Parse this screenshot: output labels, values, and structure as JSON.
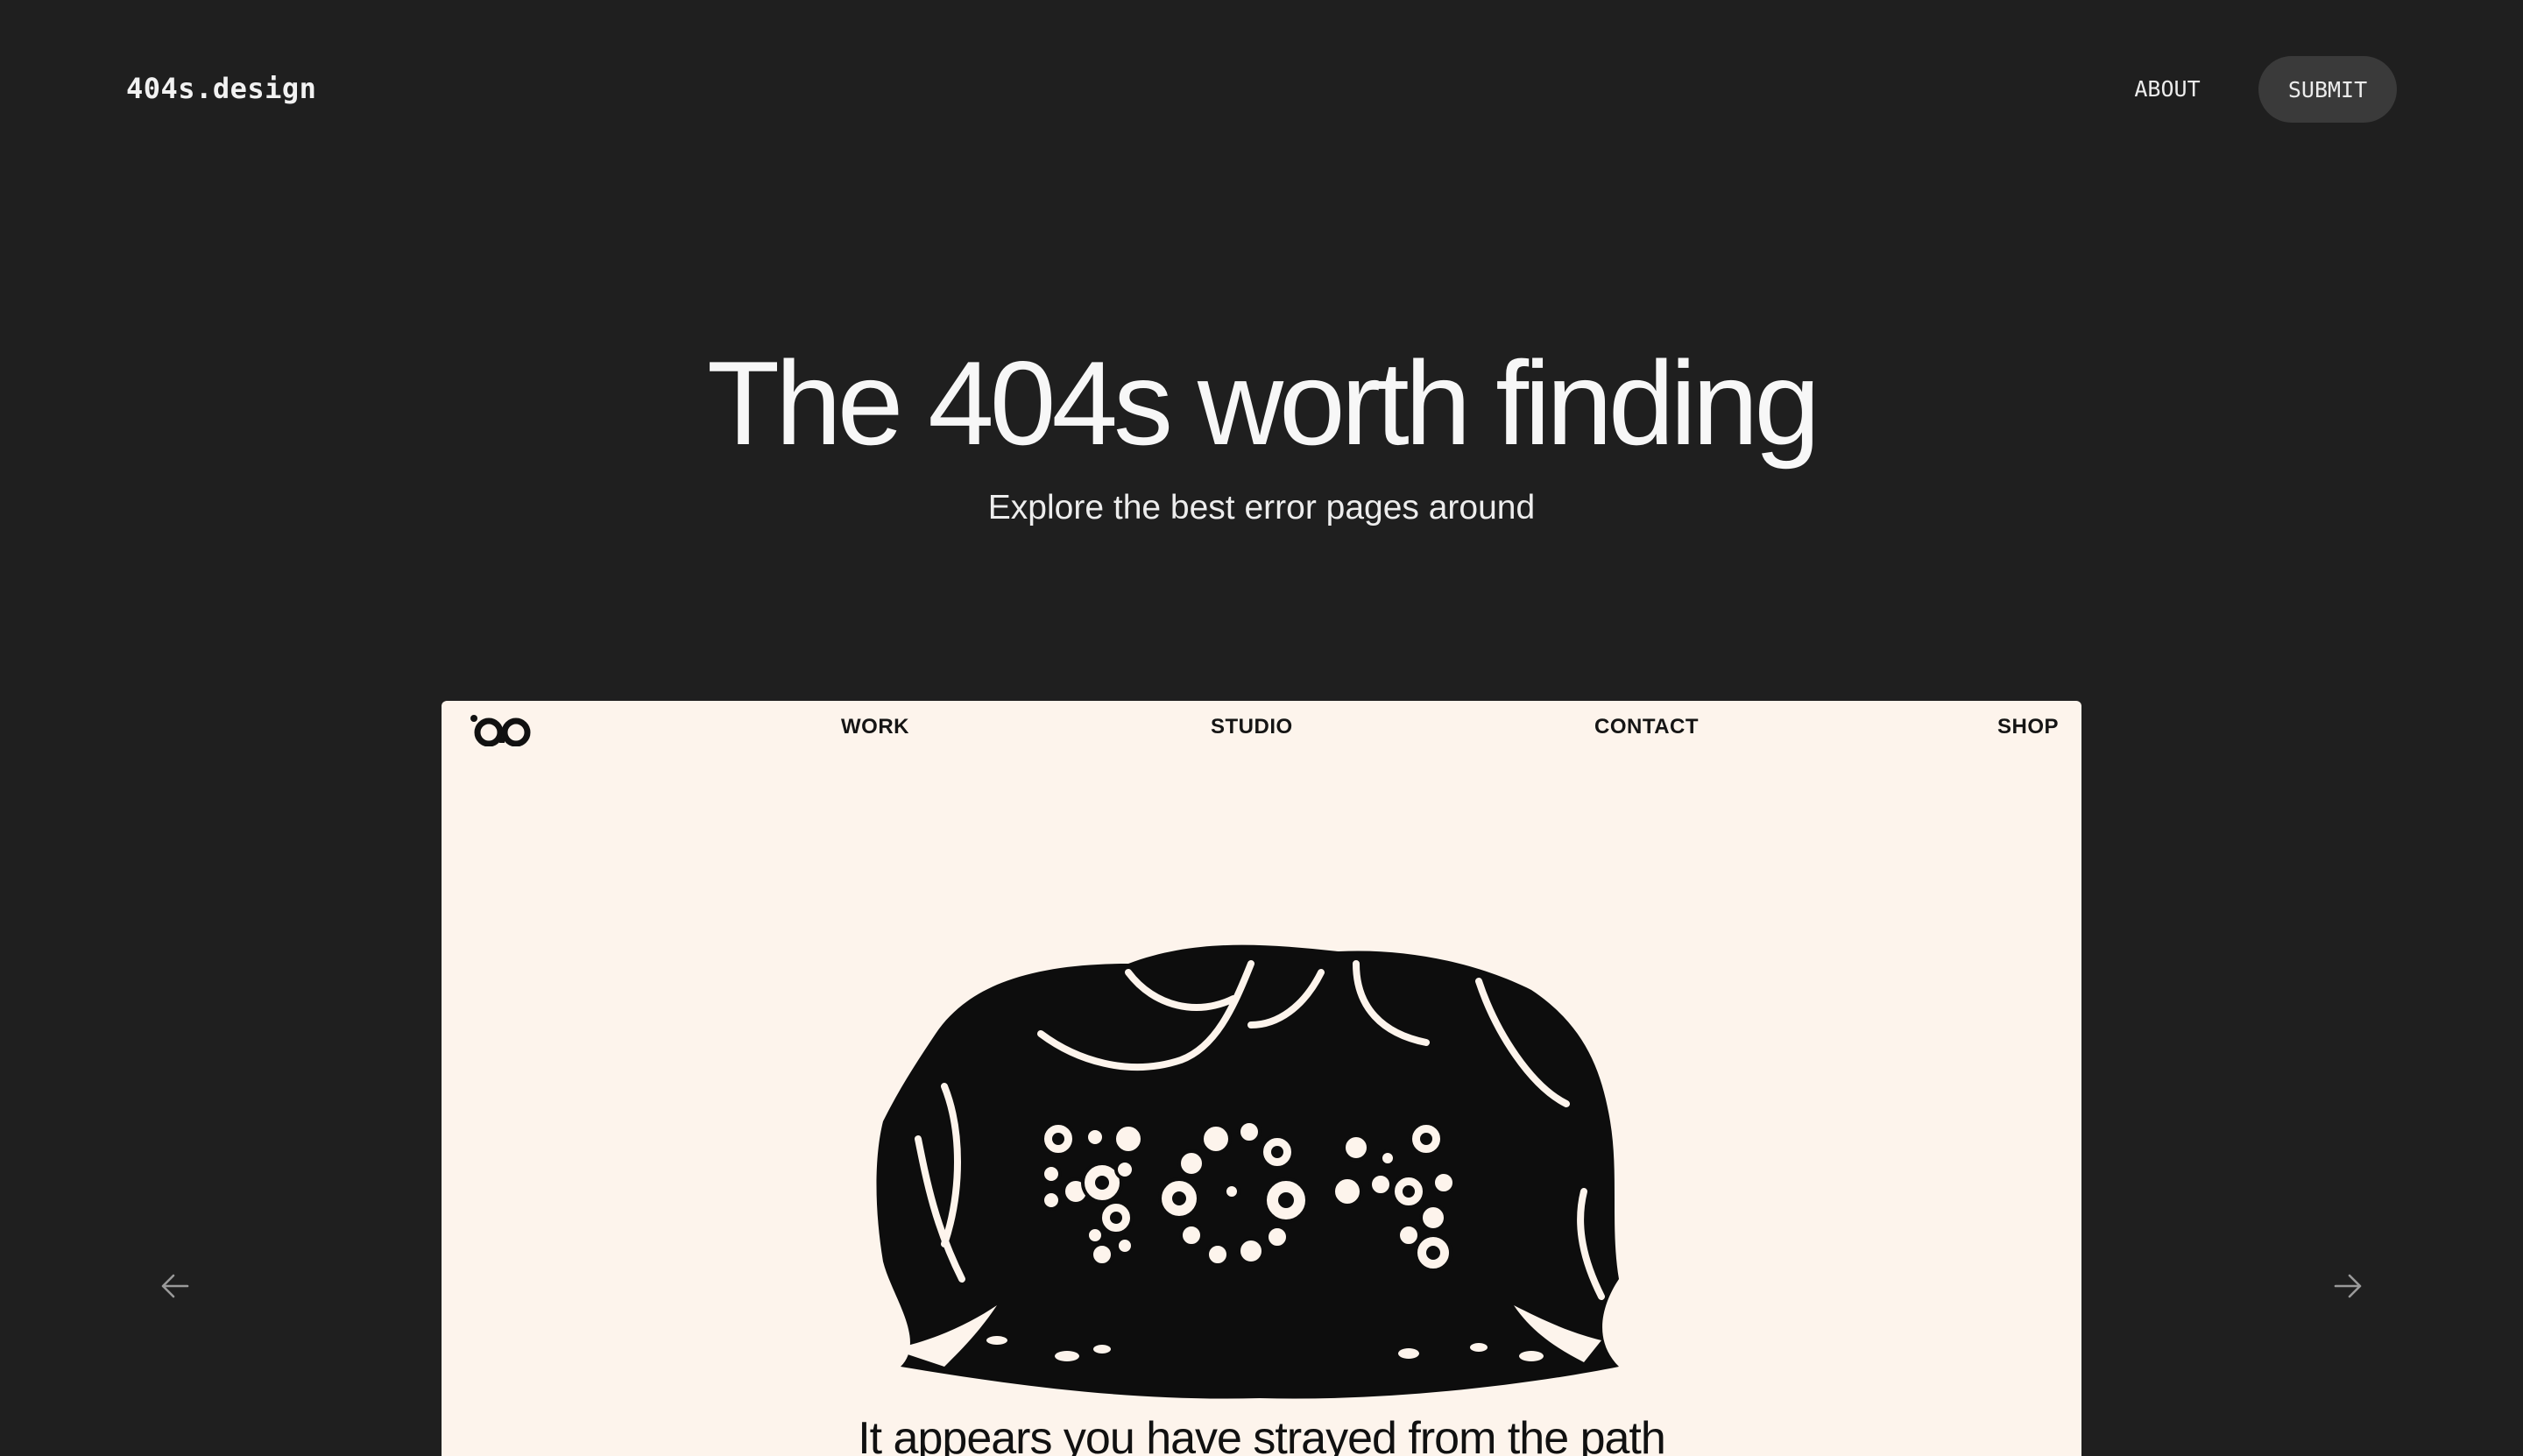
{
  "site": {
    "logo": "404s.design",
    "nav": {
      "about": "ABOUT",
      "submit": "SUBMIT"
    }
  },
  "hero": {
    "title": "The 404s worth finding",
    "subtitle": "Explore the best error pages around"
  },
  "carousel": {
    "prev_icon": "arrow-left-icon",
    "next_icon": "arrow-right-icon"
  },
  "preview": {
    "nav": {
      "work": "WORK",
      "studio": "STUDIO",
      "contact": "CONTACT",
      "shop": "SHOP"
    },
    "message": "It appears you have strayed from the path",
    "colors": {
      "background": "#fdf4ec",
      "ink": "#111111"
    }
  },
  "colors": {
    "page_background": "#1f1f1f",
    "button_background": "#3a3a3a"
  }
}
